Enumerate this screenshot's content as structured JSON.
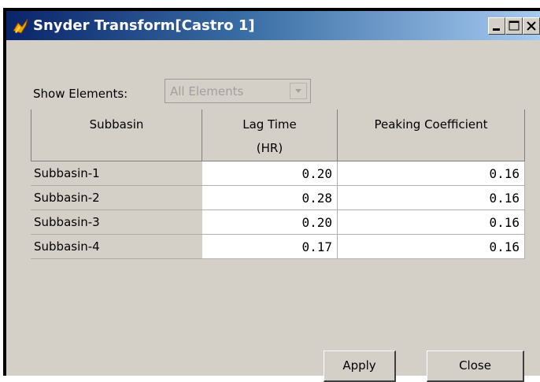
{
  "window": {
    "title": "Snyder Transform[Castro 1]",
    "icon": "hec-hms-app-icon"
  },
  "controls": {
    "minimize": "minimize-icon",
    "maximize": "maximize-icon",
    "close": "close-icon"
  },
  "filter": {
    "label": "Show Elements:",
    "selected": "All Elements"
  },
  "table": {
    "headers": {
      "subbasin": "Subbasin",
      "lag_line1": "Lag Time",
      "lag_line2": "(HR)",
      "peaking": "Peaking Coefficient"
    },
    "rows": [
      {
        "name": "Subbasin-1",
        "lag": "0.20",
        "peak": "0.16"
      },
      {
        "name": "Subbasin-2",
        "lag": "0.28",
        "peak": "0.16"
      },
      {
        "name": "Subbasin-3",
        "lag": "0.20",
        "peak": "0.16"
      },
      {
        "name": "Subbasin-4",
        "lag": "0.17",
        "peak": "0.16"
      }
    ]
  },
  "buttons": {
    "apply": "Apply",
    "close": "Close"
  },
  "colors": {
    "titlebar_start": "#0a246a",
    "titlebar_end": "#a6caf0",
    "face": "#d4d0c8"
  }
}
